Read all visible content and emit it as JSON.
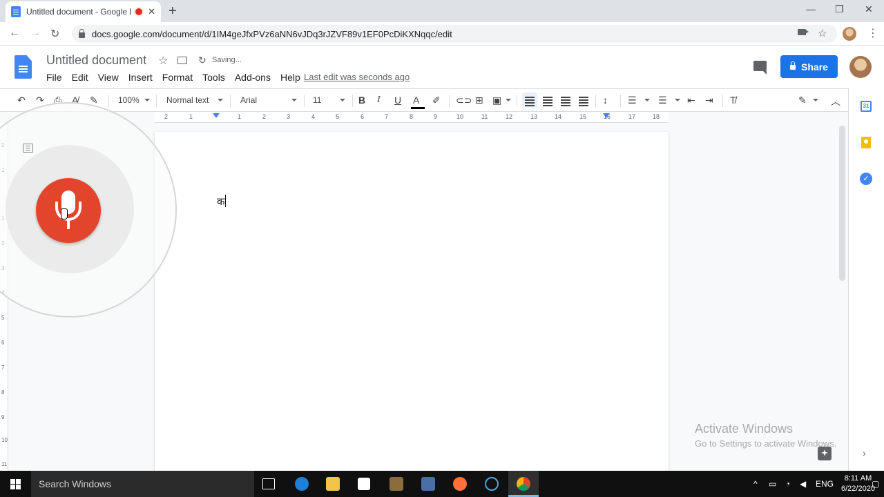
{
  "browser": {
    "tab_title": "Untitled document - Google Docs",
    "tab_close": "✕",
    "new_tab": "+",
    "url": "docs.google.com/document/d/1IM4geJfxPVz6aNN6vJDq3rJZVF89v1EF0PcDiKXNqqc/edit",
    "window_controls": {
      "minimize": "—",
      "restore": "❐",
      "close": "✕"
    }
  },
  "docs_header": {
    "title": "Untitled document",
    "saving": "Saving...",
    "menu": [
      "File",
      "Edit",
      "View",
      "Insert",
      "Format",
      "Tools",
      "Add-ons",
      "Help"
    ],
    "last_edit": "Last edit was seconds ago",
    "share_label": "Share"
  },
  "format_toolbar": {
    "zoom": "100%",
    "style": "Normal text",
    "font": "Arial",
    "size": "11"
  },
  "ruler": {
    "marks": [
      "2",
      "1",
      "1",
      "2",
      "3",
      "4",
      "5",
      "6",
      "7",
      "8",
      "9",
      "10",
      "11",
      "12",
      "13",
      "14",
      "15",
      "16",
      "17",
      "18"
    ]
  },
  "vertical_ruler": {
    "marks": [
      "2",
      "1",
      "1",
      "2",
      "3",
      "4",
      "5",
      "6",
      "7",
      "8",
      "9",
      "10",
      "11"
    ]
  },
  "document": {
    "text": "क"
  },
  "side_panel": {
    "calendar_label": "31"
  },
  "watermark": {
    "title": "Activate Windows",
    "subtitle": "Go to Settings to activate Windows."
  },
  "taskbar": {
    "search_placeholder": "Search Windows",
    "language": "ENG",
    "time": "8:11 AM",
    "date": "6/22/2020"
  },
  "colors": {
    "accent": "#1a73e8",
    "mic_red": "#e2452b",
    "taskbar": "#101010"
  }
}
